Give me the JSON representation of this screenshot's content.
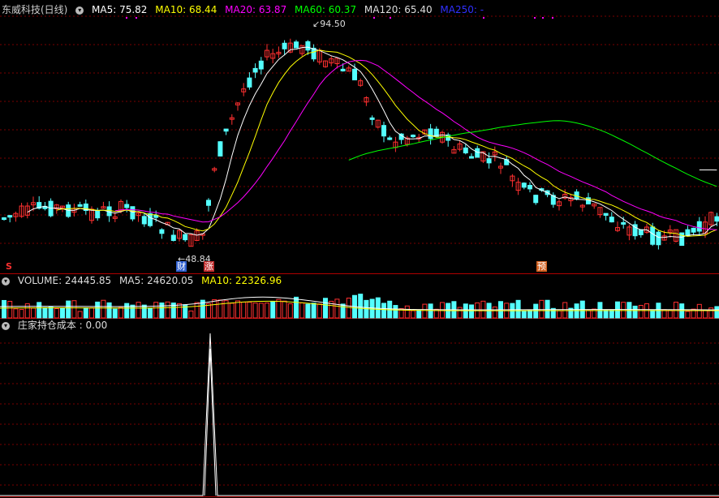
{
  "main": {
    "title": "东威科技(日线)",
    "ma5": "MA5: 75.82",
    "ma10": "MA10: 68.44",
    "ma20": "MA20: 63.87",
    "ma60": "MA60: 60.37",
    "ma120": "MA120: 65.40",
    "ma250": "MA250: -",
    "high_label": "94.50",
    "low_label": "48.84",
    "markers": {
      "s": "S",
      "cai": "财",
      "zhang": "涨",
      "yu": "预"
    },
    "colors": {
      "ma5": "#ffffff",
      "ma10": "#ffff00",
      "ma20": "#ff00ff",
      "ma60": "#00ff00",
      "ma120": "#ffffff",
      "ma250": "#0000ff",
      "up": "#ff3030",
      "down": "#54ffff"
    }
  },
  "volume": {
    "title": "VOLUME: 24445.85",
    "ma5": "MA5: 24620.05",
    "ma10": "MA10: 22326.96"
  },
  "indicator": {
    "title": "庄家持仓成本 : 0.00"
  }
}
